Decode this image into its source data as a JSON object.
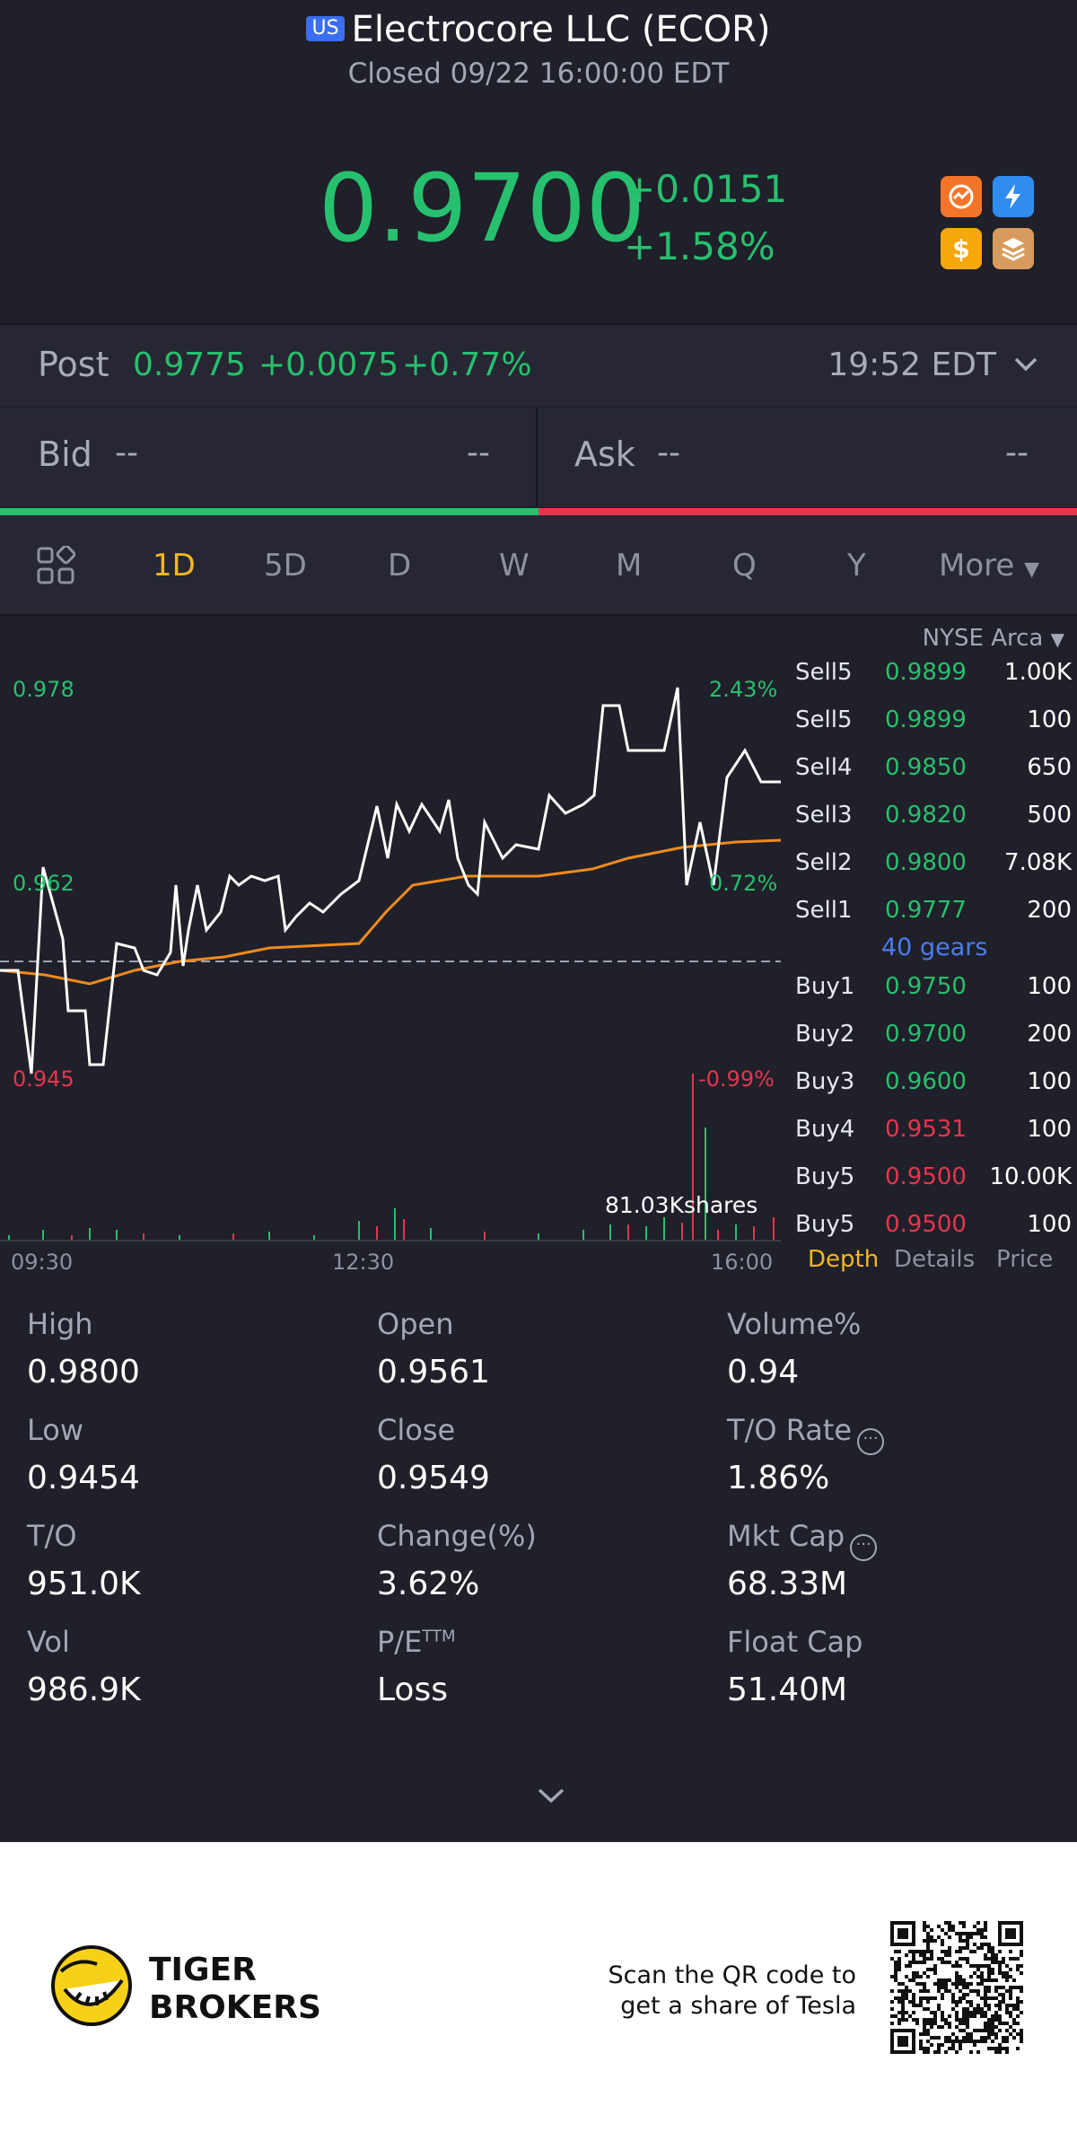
{
  "header": {
    "badge": "US",
    "title": "Electrocore LLC (ECOR)",
    "status": "Closed 09/22 16:00:00 EDT",
    "price": "0.9700",
    "change": "+0.0151",
    "change_pct": "+1.58%"
  },
  "icons": [
    "fire-icon",
    "lightning-icon",
    "dollar-icon",
    "layers-icon"
  ],
  "post": {
    "label": "Post",
    "price": "0.9775",
    "change": "+0.0075",
    "change_pct": "+0.77%",
    "time": "19:52 EDT"
  },
  "bidask": {
    "bid_label": "Bid",
    "bid_price": "--",
    "bid_qty": "--",
    "ask_label": "Ask",
    "ask_price": "--",
    "ask_qty": "--"
  },
  "tabs": [
    "1D",
    "5D",
    "D",
    "W",
    "M",
    "Q",
    "Y",
    "More"
  ],
  "active_tab": "1D",
  "chart": {
    "y_top": "0.978",
    "y_mid": "0.962",
    "y_bot": "0.945",
    "pct_top": "2.43%",
    "pct_mid": "0.72%",
    "pct_bot": "-0.99%",
    "volume_label": "81.03Kshares",
    "x_labels": [
      "09:30",
      "12:30",
      "16:00"
    ]
  },
  "chart_data": {
    "type": "line",
    "x_range": [
      "09:30",
      "16:00"
    ],
    "ylim": [
      0.945,
      0.978
    ],
    "pct_range": [
      "-0.99%",
      "2.43%"
    ],
    "prev_close": 0.9549,
    "series": [],
    "volume_max": "81.03Kshares"
  },
  "depth": {
    "exchange": "NYSE Arca",
    "gears": "40 gears",
    "sell": [
      {
        "name": "Sell5",
        "price": "0.9899",
        "qty": "1.00K"
      },
      {
        "name": "Sell5",
        "price": "0.9899",
        "qty": "100"
      },
      {
        "name": "Sell4",
        "price": "0.9850",
        "qty": "650"
      },
      {
        "name": "Sell3",
        "price": "0.9820",
        "qty": "500"
      },
      {
        "name": "Sell2",
        "price": "0.9800",
        "qty": "7.08K"
      },
      {
        "name": "Sell1",
        "price": "0.9777",
        "qty": "200"
      }
    ],
    "buy": [
      {
        "name": "Buy1",
        "price": "0.9750",
        "qty": "100"
      },
      {
        "name": "Buy2",
        "price": "0.9700",
        "qty": "200"
      },
      {
        "name": "Buy3",
        "price": "0.9600",
        "qty": "100"
      },
      {
        "name": "Buy4",
        "price": "0.9531",
        "qty": "100"
      },
      {
        "name": "Buy5",
        "price": "0.9500",
        "qty": "10.00K"
      },
      {
        "name": "Buy5",
        "price": "0.9500",
        "qty": "100"
      }
    ],
    "tabs": [
      "Depth",
      "Details",
      "Price"
    ]
  },
  "stats": [
    {
      "label": "High",
      "value": "0.9800"
    },
    {
      "label": "Open",
      "value": "0.9561"
    },
    {
      "label": "Volume%",
      "value": "0.94"
    },
    {
      "label": "Low",
      "value": "0.9454"
    },
    {
      "label": "Close",
      "value": "0.9549"
    },
    {
      "label": "T/O Rate",
      "value": "1.86%"
    },
    {
      "label": "T/O",
      "value": "951.0K"
    },
    {
      "label": "Change(%)",
      "value": "3.62%"
    },
    {
      "label": "Mkt Cap",
      "value": "68.33M"
    },
    {
      "label": "Vol",
      "value": "986.9K"
    },
    {
      "label": "P/E",
      "sup": "TTM",
      "value": "Loss"
    },
    {
      "label": "Float Cap",
      "value": "51.40M"
    }
  ],
  "footer": {
    "brand_line1": "TIGER",
    "brand_line2": "BROKERS",
    "scan_line1": "Scan the QR code to",
    "scan_line2": "get a share of Tesla"
  },
  "colors": {
    "green": "#27c06e",
    "red": "#e8344e",
    "orange": "#f08a1d",
    "accent_yellow": "#f4b71e",
    "blue": "#4b7cf0"
  }
}
